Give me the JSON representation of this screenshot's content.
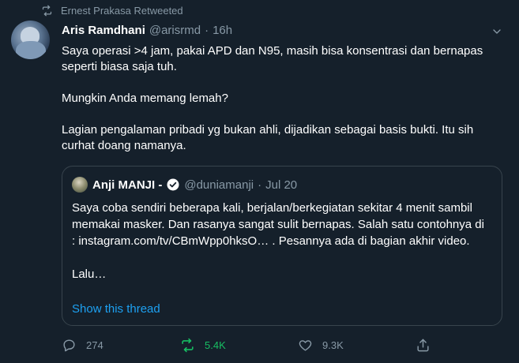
{
  "retweet_context": {
    "text": "Ernest Prakasa Retweeted",
    "icon": "retweet-icon"
  },
  "tweet": {
    "author_name": "Aris Ramdhani",
    "handle": "@arisrmd",
    "separator": "·",
    "time": "16h",
    "lines": [
      "Saya operasi >4 jam, pakai APD dan N95, masih bisa konsentrasi dan bernapas seperti biasa saja tuh.",
      "Mungkin Anda memang lemah?",
      "Lagian pengalaman pribadi yg bukan ahli, dijadikan sebagai basis bukti. Itu sih curhat doang namanya."
    ]
  },
  "quoted": {
    "author_name": "Anji MANJI -",
    "handle": "@duniamanji",
    "separator": "·",
    "date": "Jul 20",
    "paragraph": "Saya coba sendiri beberapa kali, berjalan/berkegiatan sekitar 4 menit sambil memakai masker. Dan rasanya sangat sulit bernapas. Salah satu contohnya di : instagram.com/tv/CBmWpp0hksO… . Pesannya ada di bagian akhir video.",
    "ellipsis_line": "Lalu…",
    "show_thread": "Show this thread"
  },
  "actions": {
    "replies": "274",
    "retweets": "5.4K",
    "likes": "9.3K"
  },
  "colors": {
    "background": "#15202b",
    "text": "#ffffff",
    "secondary": "#8899a6",
    "link": "#1da1f2",
    "retweet_active": "#17bf63",
    "border": "#38444d"
  }
}
